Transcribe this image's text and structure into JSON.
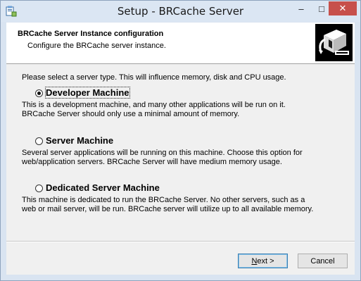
{
  "window": {
    "title": "Setup - BRCache Server",
    "controls": {
      "minimize": "–",
      "maximize": "□",
      "close": "✕"
    },
    "icon": "installer-icon"
  },
  "banner": {
    "title": "BRCache Server Instance configuration",
    "subtitle": "Configure the BRCache server instance.",
    "image": "computer-install-graphic"
  },
  "main": {
    "prompt": "Please select a server type. This will influence memory, disk and CPU usage.",
    "options": [
      {
        "label": "Developer Machine",
        "selected": true,
        "description_line1": "This is a development machine, and many other applications will be run on it.",
        "description_line2": "BRCache Server should only use a minimal amount of memory."
      },
      {
        "label": "Server Machine",
        "selected": false,
        "description_line1": "Several server applications will be running on this machine. Choose this option for",
        "description_line2": "web/application servers. BRCache Server will have medium memory usage."
      },
      {
        "label": "Dedicated Server Machine",
        "selected": false,
        "description_line1": "This machine is dedicated to run the BRCache Server. No other servers, such as a",
        "description_line2": "web or mail server, will be run. BRCache server will utilize up to all available memory."
      }
    ]
  },
  "footer": {
    "next_mnemonic": "N",
    "next_rest": "ext >",
    "cancel_label": "Cancel"
  },
  "colors": {
    "titlebar": "#dbe6f3",
    "close_button": "#c7504b",
    "default_button_border": "#3c7fb1"
  }
}
